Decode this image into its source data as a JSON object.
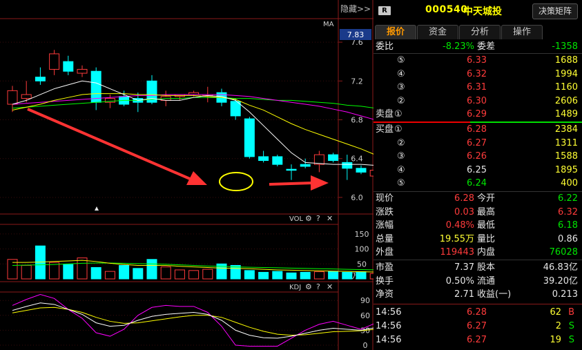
{
  "chart": {
    "hide_label": "隐藏>>",
    "ma_label": "MA",
    "current_price_tag": "7.83",
    "price_axis": [
      "7.6",
      "7.2",
      "6.8",
      "6.4",
      "6.0"
    ],
    "vol": {
      "label": "VOL",
      "axis": [
        "150",
        "100",
        "50"
      ],
      "unit": "X万"
    },
    "kdj": {
      "label": "KDJ",
      "axis": [
        "90",
        "60",
        "30",
        "0"
      ]
    },
    "colors": {
      "up": "#ff3b3b",
      "down": "#00ffff",
      "ma5": "#ffffff",
      "ma10": "#ffff00",
      "ma20": "#ff00ff",
      "ma30": "#00ff00",
      "annotation": "#ff3333",
      "circle": "#ffff00"
    }
  },
  "chart_data": {
    "type": "candlestick",
    "y_range": [
      5.9,
      7.75
    ],
    "candles": [
      {
        "o": 6.96,
        "h": 7.15,
        "l": 6.88,
        "c": 7.1
      },
      {
        "o": 7.02,
        "h": 7.2,
        "l": 6.98,
        "c": 7.06
      },
      {
        "o": 7.24,
        "h": 7.34,
        "l": 7.16,
        "c": 7.2
      },
      {
        "o": 7.32,
        "h": 7.52,
        "l": 7.26,
        "c": 7.48
      },
      {
        "o": 7.4,
        "h": 7.46,
        "l": 7.26,
        "c": 7.3
      },
      {
        "o": 7.28,
        "h": 7.36,
        "l": 7.24,
        "c": 7.32
      },
      {
        "o": 7.3,
        "h": 7.34,
        "l": 6.9,
        "c": 6.98
      },
      {
        "o": 6.98,
        "h": 7.06,
        "l": 6.92,
        "c": 7.02
      },
      {
        "o": 7.04,
        "h": 7.1,
        "l": 6.94,
        "c": 6.96
      },
      {
        "o": 7.02,
        "h": 7.08,
        "l": 6.88,
        "c": 6.98
      },
      {
        "o": 7.2,
        "h": 7.26,
        "l": 6.96,
        "c": 6.98
      },
      {
        "o": 7.0,
        "h": 7.1,
        "l": 6.94,
        "c": 7.04
      },
      {
        "o": 7.04,
        "h": 7.06,
        "l": 7.0,
        "c": 7.06
      },
      {
        "o": 7.06,
        "h": 7.1,
        "l": 7.04,
        "c": 7.08
      },
      {
        "o": 7.06,
        "h": 7.14,
        "l": 6.98,
        "c": 7.06
      },
      {
        "o": 7.08,
        "h": 7.12,
        "l": 6.94,
        "c": 6.98
      },
      {
        "o": 6.99,
        "h": 7.02,
        "l": 6.8,
        "c": 6.84
      },
      {
        "o": 6.81,
        "h": 6.83,
        "l": 6.4,
        "c": 6.42
      },
      {
        "o": 6.42,
        "h": 6.48,
        "l": 6.36,
        "c": 6.38
      },
      {
        "o": 6.42,
        "h": 6.44,
        "l": 6.32,
        "c": 6.34
      },
      {
        "o": 6.29,
        "h": 6.34,
        "l": 6.18,
        "c": 6.28
      },
      {
        "o": 6.34,
        "h": 6.4,
        "l": 6.3,
        "c": 6.32
      },
      {
        "o": 6.34,
        "h": 6.48,
        "l": 6.26,
        "c": 6.44
      },
      {
        "o": 6.44,
        "h": 6.46,
        "l": 6.36,
        "c": 6.38
      },
      {
        "o": 6.36,
        "h": 6.44,
        "l": 6.18,
        "c": 6.3
      },
      {
        "o": 6.3,
        "h": 6.33,
        "l": 6.24,
        "c": 6.26
      },
      {
        "o": 6.22,
        "h": 6.32,
        "l": 6.2,
        "c": 6.28
      }
    ],
    "ma5": [
      6.96,
      7.0,
      7.06,
      7.12,
      7.16,
      7.2,
      7.18,
      7.12,
      7.06,
      7.0,
      7.02,
      7.0,
      7.0,
      7.03,
      7.05,
      7.04,
      7.0,
      6.88,
      6.74,
      6.6,
      6.46,
      6.36,
      6.35,
      6.34,
      6.34,
      6.34,
      6.33
    ],
    "ma10": [
      6.9,
      6.93,
      6.96,
      7.0,
      7.03,
      7.06,
      7.07,
      7.07,
      7.07,
      7.06,
      7.06,
      7.05,
      7.05,
      7.05,
      7.04,
      7.03,
      7.01,
      6.95,
      6.9,
      6.83,
      6.76,
      6.7,
      6.65,
      6.6,
      6.55,
      6.5,
      6.44
    ],
    "ma20": [
      6.96,
      6.97,
      6.98,
      6.99,
      7.0,
      7.01,
      7.02,
      7.03,
      7.04,
      7.05,
      7.05,
      7.06,
      7.06,
      7.06,
      7.06,
      7.06,
      7.05,
      7.04,
      7.02,
      7.0,
      6.98,
      6.96,
      6.94,
      6.91,
      6.88,
      6.84,
      6.8
    ],
    "ma30": [
      6.92,
      6.93,
      6.94,
      6.95,
      6.96,
      6.97,
      6.98,
      6.99,
      7.0,
      7.0,
      7.01,
      7.02,
      7.02,
      7.03,
      7.03,
      7.03,
      7.02,
      7.02,
      7.01,
      7.0,
      7.0,
      6.99,
      6.98,
      6.97,
      6.95,
      6.94,
      6.92
    ],
    "vol": {
      "y_range": [
        0,
        175
      ],
      "values": [
        65,
        45,
        110,
        55,
        48,
        70,
        38,
        25,
        45,
        35,
        65,
        40,
        30,
        28,
        32,
        50,
        45,
        28,
        22,
        25,
        20,
        22,
        24,
        25,
        22,
        24,
        18
      ],
      "ma5": [
        55,
        55,
        56,
        58,
        60,
        62,
        58,
        52,
        48,
        45,
        45,
        45,
        42,
        40,
        38,
        36,
        35,
        34,
        32,
        30,
        29,
        28,
        27,
        26,
        25,
        24,
        23
      ],
      "ma10": [
        45,
        46,
        47,
        48,
        50,
        52,
        53,
        53,
        52,
        51,
        50,
        49,
        47,
        45,
        43,
        42,
        40,
        39,
        38,
        37,
        36,
        35,
        34,
        33,
        32,
        31,
        30
      ]
    },
    "kdj": {
      "y_range": [
        0,
        100
      ],
      "k": [
        70,
        78,
        85,
        82,
        72,
        62,
        45,
        38,
        40,
        50,
        58,
        62,
        64,
        66,
        62,
        50,
        30,
        20,
        15,
        14,
        18,
        24,
        30,
        34,
        32,
        30,
        35
      ],
      "d": [
        65,
        70,
        75,
        76,
        72,
        66,
        56,
        48,
        44,
        45,
        49,
        53,
        57,
        60,
        60,
        56,
        46,
        36,
        28,
        22,
        20,
        21,
        24,
        27,
        28,
        29,
        32
      ],
      "j": [
        80,
        92,
        104,
        94,
        72,
        54,
        25,
        18,
        32,
        60,
        76,
        80,
        78,
        78,
        66,
        38,
        0,
        -12,
        -10,
        -2,
        14,
        30,
        42,
        48,
        40,
        32,
        44
      ]
    }
  },
  "panel": {
    "badge": "R",
    "code": "000540",
    "name": "中天城投",
    "decision_btn": "决策矩阵",
    "tabs": [
      {
        "label": "报价",
        "active": true
      },
      {
        "label": "资金",
        "active": false
      },
      {
        "label": "分析",
        "active": false
      },
      {
        "label": "操作",
        "active": false
      }
    ],
    "wei": {
      "label1": "委比",
      "val1": "-8.23%",
      "label2": "委差",
      "val2": "-1358"
    },
    "asks": [
      {
        "lvl": "⑤",
        "price": "6.33",
        "vol": "1688"
      },
      {
        "lvl": "④",
        "price": "6.32",
        "vol": "1994"
      },
      {
        "lvl": "③",
        "price": "6.31",
        "vol": "1160"
      },
      {
        "lvl": "②",
        "price": "6.30",
        "vol": "2606"
      },
      {
        "lvl": "①",
        "prefix": "卖盘",
        "price": "6.29",
        "vol": "1489"
      }
    ],
    "bids": [
      {
        "lvl": "①",
        "prefix": "买盘",
        "price": "6.28",
        "vol": "2384",
        "pcolor": "red"
      },
      {
        "lvl": "②",
        "price": "6.27",
        "vol": "1311",
        "pcolor": "red"
      },
      {
        "lvl": "③",
        "price": "6.26",
        "vol": "1588",
        "pcolor": "red"
      },
      {
        "lvl": "④",
        "price": "6.25",
        "vol": "1895",
        "pcolor": "white"
      },
      {
        "lvl": "⑤",
        "price": "6.24",
        "vol": "400",
        "pcolor": "green"
      }
    ],
    "quote": [
      {
        "l1": "现价",
        "v1": "6.28",
        "c1": "red",
        "l2": "今开",
        "v2": "6.22",
        "c2": "green"
      },
      {
        "l1": "涨跌",
        "v1": "0.03",
        "c1": "red",
        "l2": "最高",
        "v2": "6.32",
        "c2": "red"
      },
      {
        "l1": "涨幅",
        "v1": "0.48%",
        "c1": "red",
        "l2": "最低",
        "v2": "6.18",
        "c2": "green"
      },
      {
        "l1": "总量",
        "v1": "19.55万",
        "c1": "yellow",
        "l2": "量比",
        "v2": "0.86",
        "c2": "white"
      },
      {
        "l1": "外盘",
        "v1": "119443",
        "c1": "red",
        "l2": "内盘",
        "v2": "76028",
        "c2": "green"
      }
    ],
    "fundamentals": [
      {
        "l1": "市盈",
        "v1": "7.37",
        "l2": "股本",
        "v2": "46.83亿"
      },
      {
        "l1": "换手",
        "v1": "0.50%",
        "l2": "流通",
        "v2": "39.20亿"
      },
      {
        "l1": "净资",
        "v1": "2.71",
        "l2": "收益(一)",
        "v2": "0.213"
      }
    ],
    "ticks": [
      {
        "time": "14:56",
        "price": "6.28",
        "vol": "62",
        "side": "B",
        "side_color": "red"
      },
      {
        "time": "14:56",
        "price": "6.27",
        "vol": "2",
        "side": "S",
        "side_color": "green"
      },
      {
        "time": "14:56",
        "price": "6.27",
        "vol": "19",
        "side": "S",
        "side_color": "green"
      }
    ]
  }
}
